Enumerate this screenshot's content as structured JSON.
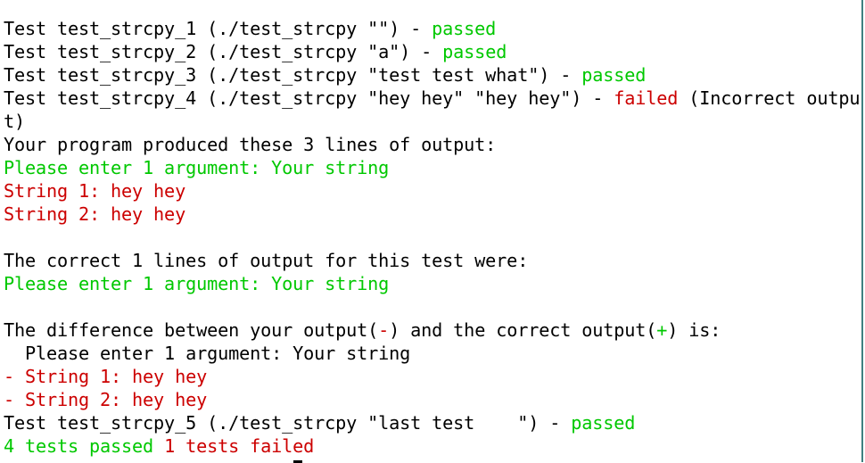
{
  "colors": {
    "pass": "#00c800",
    "fail": "#cc0000",
    "text": "#000000",
    "border": "#3f8080"
  },
  "lines": [
    {
      "parts": [
        {
          "t": "Test test_strcpy_1 (./test_strcpy \"\") - ",
          "c": ""
        },
        {
          "t": "passed",
          "c": "g"
        }
      ]
    },
    {
      "parts": [
        {
          "t": "Test test_strcpy_2 (./test_strcpy \"a\") - ",
          "c": ""
        },
        {
          "t": "passed",
          "c": "g"
        }
      ]
    },
    {
      "parts": [
        {
          "t": "Test test_strcpy_3 (./test_strcpy \"test test what\") - ",
          "c": ""
        },
        {
          "t": "passed",
          "c": "g"
        }
      ]
    },
    {
      "parts": [
        {
          "t": "Test test_strcpy_4 (./test_strcpy \"hey hey\" \"hey hey\") - ",
          "c": ""
        },
        {
          "t": "failed",
          "c": "r"
        },
        {
          "t": " (Incorrect outpu",
          "c": ""
        }
      ]
    },
    {
      "parts": [
        {
          "t": "t)",
          "c": ""
        }
      ]
    },
    {
      "parts": [
        {
          "t": "Your program produced these 3 lines of output:",
          "c": ""
        }
      ]
    },
    {
      "parts": [
        {
          "t": "Please enter 1 argument: Your string",
          "c": "g"
        }
      ]
    },
    {
      "parts": [
        {
          "t": "String 1: hey hey",
          "c": "r"
        }
      ]
    },
    {
      "parts": [
        {
          "t": "String 2: hey hey",
          "c": "r"
        }
      ]
    },
    {
      "parts": [
        {
          "t": "",
          "c": ""
        }
      ]
    },
    {
      "parts": [
        {
          "t": "The correct 1 lines of output for this test were:",
          "c": ""
        }
      ]
    },
    {
      "parts": [
        {
          "t": "Please enter 1 argument: Your string",
          "c": "g"
        }
      ]
    },
    {
      "parts": [
        {
          "t": "",
          "c": ""
        }
      ]
    },
    {
      "parts": [
        {
          "t": "The difference between your output(",
          "c": ""
        },
        {
          "t": "-",
          "c": "r"
        },
        {
          "t": ") and the correct output(",
          "c": ""
        },
        {
          "t": "+",
          "c": "g"
        },
        {
          "t": ") is:",
          "c": ""
        }
      ]
    },
    {
      "parts": [
        {
          "t": "  Please enter 1 argument: Your string",
          "c": ""
        }
      ]
    },
    {
      "parts": [
        {
          "t": "- String 1: hey hey",
          "c": "r"
        }
      ]
    },
    {
      "parts": [
        {
          "t": "- String 2: hey hey",
          "c": "r"
        }
      ]
    },
    {
      "parts": [
        {
          "t": "Test test_strcpy_5 (./test_strcpy \"last test    \") - ",
          "c": ""
        },
        {
          "t": "passed",
          "c": "g"
        }
      ]
    },
    {
      "parts": [
        {
          "t": "4 tests passed",
          "c": "g"
        },
        {
          "t": " 1 tests fail",
          "c": "r"
        },
        {
          "t": "e",
          "c": "r cursor"
        },
        {
          "t": "d",
          "c": "r"
        }
      ]
    }
  ]
}
